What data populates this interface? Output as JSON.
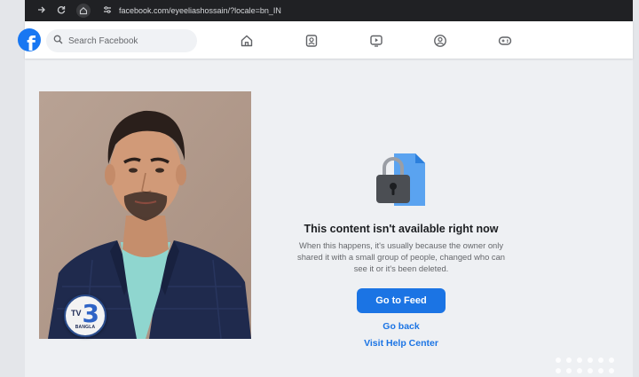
{
  "browser": {
    "url": "facebook.com/eyeeliashossain/?locale=bn_IN"
  },
  "fb_nav": {
    "logo_letter": "f",
    "search_placeholder": "Search Facebook",
    "icons": [
      "home-icon",
      "friends-icon",
      "watch-icon",
      "groups-icon",
      "gaming-icon"
    ]
  },
  "content": {
    "title": "This content isn't available right now",
    "body_lines": [
      "When this happens, it's usually because the owner only",
      "shared it with a small group of people, changed who can",
      "see it or it's been deleted."
    ],
    "primary_button": "Go to Feed",
    "link_back": "Go back",
    "link_help": "Visit Help Center"
  },
  "watermark": {
    "tv": "TV",
    "number": "3",
    "label": "BANGLA"
  },
  "colors": {
    "brand_blue": "#1877f2",
    "button_blue": "#1b74e4",
    "browser_dark": "#202124",
    "page_bg": "#eef0f3"
  }
}
